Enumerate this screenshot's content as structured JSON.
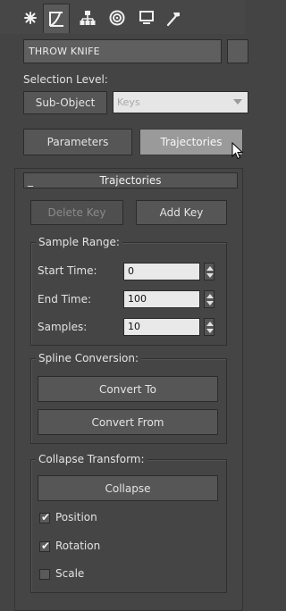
{
  "tabs": [
    {
      "icon": "create-icon",
      "active": false
    },
    {
      "icon": "modify-icon",
      "active": true
    },
    {
      "icon": "hierarchy-icon",
      "active": false
    },
    {
      "icon": "motion-icon",
      "active": false
    },
    {
      "icon": "display-icon",
      "active": false
    },
    {
      "icon": "utilities-icon",
      "active": false
    }
  ],
  "object_name": "THROW KNIFE",
  "selection_level": {
    "label": "Selection Level:",
    "sub_object_button": "Sub-Object",
    "dropdown_value": "Keys"
  },
  "mode_buttons": {
    "parameters": "Parameters",
    "trajectories": "Trajectories"
  },
  "rollout": {
    "title": "Trajectories",
    "collapse_glyph": "_",
    "delete_key": "Delete Key",
    "add_key": "Add Key"
  },
  "sample_range": {
    "title": "Sample Range:",
    "start_time_label": "Start Time:",
    "start_time_value": "0",
    "end_time_label": "End Time:",
    "end_time_value": "100",
    "samples_label": "Samples:",
    "samples_value": "10"
  },
  "spline_conversion": {
    "title": "Spline Conversion:",
    "convert_to": "Convert To",
    "convert_from": "Convert From"
  },
  "collapse_transform": {
    "title": "Collapse Transform:",
    "collapse_button": "Collapse",
    "position_label": "Position",
    "position_checked": true,
    "rotation_label": "Rotation",
    "rotation_checked": true,
    "scale_label": "Scale",
    "scale_checked": false
  },
  "colors": {
    "panel_bg": "#444444",
    "pressed_button": "#9a9a9a",
    "field_bg": "#e9e9e9"
  }
}
